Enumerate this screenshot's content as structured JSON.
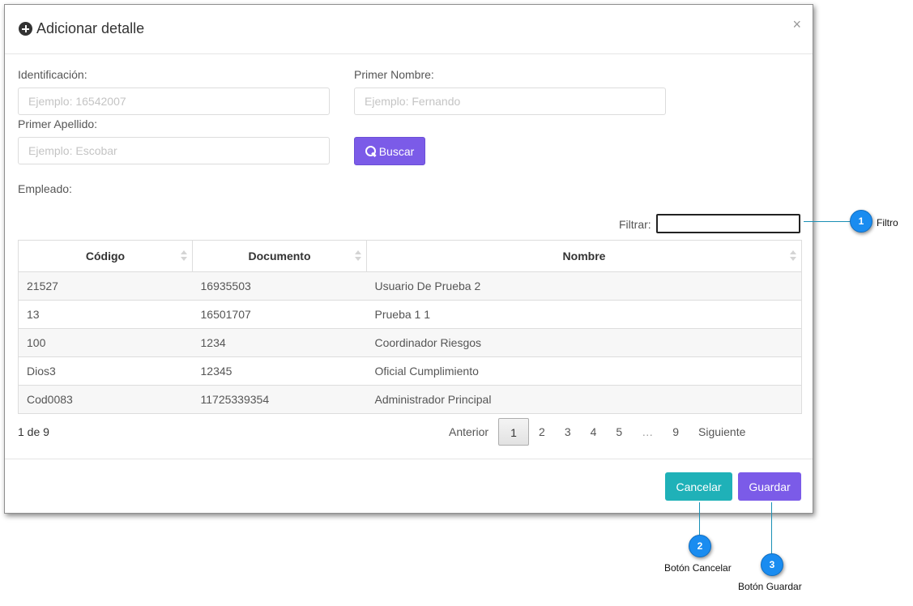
{
  "modal": {
    "title": "Adicionar detalle",
    "close_label": "×"
  },
  "form": {
    "identificacion_label": "Identificación:",
    "identificacion_placeholder": "Ejemplo: 16542007",
    "primer_nombre_label": "Primer Nombre:",
    "primer_nombre_placeholder": "Ejemplo: Fernando",
    "primer_apellido_label": "Primer Apellido:",
    "primer_apellido_placeholder": "Ejemplo: Escobar",
    "buscar_label": "Buscar",
    "empleado_label": "Empleado:"
  },
  "filter": {
    "label": "Filtrar:"
  },
  "table": {
    "headers": [
      "Código",
      "Documento",
      "Nombre"
    ],
    "rows": [
      [
        "21527",
        "16935503",
        "Usuario De Prueba 2"
      ],
      [
        "13",
        "16501707",
        "Prueba 1 1"
      ],
      [
        "100",
        "1234",
        "Coordinador Riesgos"
      ],
      [
        "Dios3",
        "12345",
        "Oficial Cumplimiento"
      ],
      [
        "Cod0083",
        "11725339354",
        "Administrador Principal"
      ]
    ]
  },
  "pagination": {
    "info": "1 de 9",
    "prev": "Anterior",
    "pages": [
      "1",
      "2",
      "3",
      "4",
      "5",
      "…",
      "9"
    ],
    "next": "Siguiente",
    "current": "1"
  },
  "footer": {
    "cancel_label": "Cancelar",
    "save_label": "Guardar"
  },
  "callouts": [
    {
      "number": "1",
      "text": "Filtro"
    },
    {
      "number": "2",
      "text": "Botón Cancelar"
    },
    {
      "number": "3",
      "text": "Botón Guardar"
    }
  ],
  "colors": {
    "primary": "#7b5be8",
    "info": "#1fb1b8",
    "callout_badge": "#1a8cf0"
  }
}
